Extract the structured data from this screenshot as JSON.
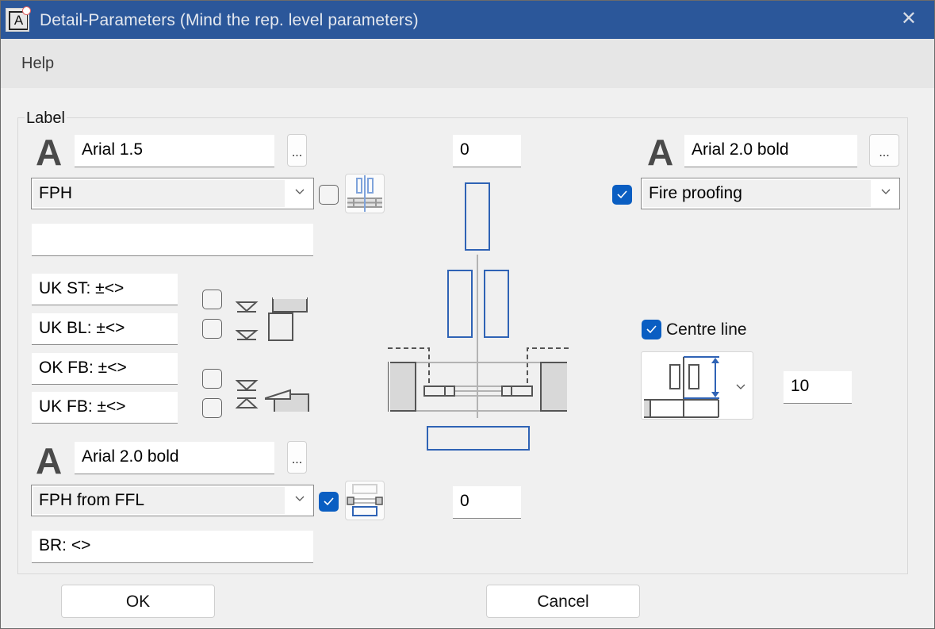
{
  "window": {
    "title": "Detail-Parameters (Mind the rep. level parameters)",
    "app_icon": "app-letter-a-icon",
    "close_icon": "close-icon",
    "close_glyph": "✕"
  },
  "menu": {
    "items": [
      {
        "label": "Help"
      }
    ]
  },
  "group": {
    "legend": "Label"
  },
  "top_left": {
    "font_glyph": "A",
    "font_value": "Arial 1.5",
    "font_button": "...",
    "combo_value": "FPH",
    "checkbox_checked": false,
    "text_value": ""
  },
  "heights": {
    "fields": [
      {
        "value": "UK ST: ±<>",
        "checked": false
      },
      {
        "value": "UK BL: ±<>",
        "checked": false
      },
      {
        "value": "OK FB: ±<>",
        "checked": false
      },
      {
        "value": "UK FB: ±<>",
        "checked": false
      }
    ]
  },
  "bottom_left": {
    "font_glyph": "A",
    "font_value": "Arial 2.0 bold",
    "font_button": "...",
    "combo_value": "FPH from FFL",
    "checkbox_checked": true,
    "text_value": "BR: <>"
  },
  "center": {
    "top_offset": "0",
    "bottom_offset": "0"
  },
  "top_right": {
    "font_glyph": "A",
    "font_value": "Arial 2.0 bold",
    "font_button": "...",
    "checkbox_checked": true,
    "combo_value": "Fire proofing"
  },
  "centre_line": {
    "checked": true,
    "label": "Centre line",
    "distance_value": "10"
  },
  "footer": {
    "ok_label": "OK",
    "cancel_label": "Cancel"
  },
  "colors": {
    "titlebar": "#2b579a",
    "accent": "#0a5ec2",
    "diagram_blue": "#2f63b5"
  }
}
